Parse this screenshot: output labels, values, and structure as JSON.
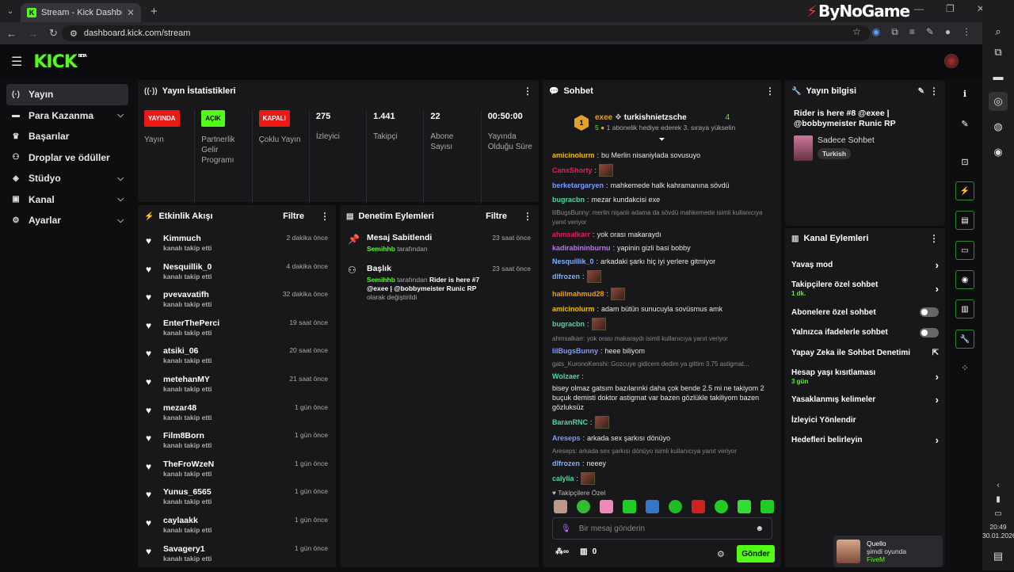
{
  "browser": {
    "tab_title": "Stream - Kick Dashboard",
    "url": "dashboard.kick.com/stream",
    "brand": "ByNoGame"
  },
  "kick": {
    "logo": "KICK",
    "beta": "BETA"
  },
  "sidebar": {
    "items": [
      {
        "label": "Yayın",
        "icon": "broadcast-icon",
        "active": true,
        "chev": false
      },
      {
        "label": "Para Kazanma",
        "icon": "money-icon",
        "active": false,
        "chev": true
      },
      {
        "label": "Başarılar",
        "icon": "trophy-icon",
        "active": false,
        "chev": false
      },
      {
        "label": "Droplar ve ödüller",
        "icon": "gift-icon",
        "active": false,
        "chev": false
      },
      {
        "label": "Stüdyo",
        "icon": "studio-icon",
        "active": false,
        "chev": true
      },
      {
        "label": "Kanal",
        "icon": "channel-icon",
        "active": false,
        "chev": true
      },
      {
        "label": "Ayarlar",
        "icon": "gear-icon",
        "active": false,
        "chev": true
      }
    ]
  },
  "stats": {
    "title": "Yayın İstatistikleri",
    "items": [
      {
        "badge": "YAYINDA",
        "badge_color": "#e91916",
        "label": "Yayın"
      },
      {
        "badge": "AÇIK",
        "badge_color": "#53fc18",
        "label": "Partnerlik Gelir Programı"
      },
      {
        "badge": "KAPALI",
        "badge_color": "#e91916",
        "label": "Çoklu Yayın"
      },
      {
        "num": "275",
        "label": "İzleyici"
      },
      {
        "num": "1.441",
        "label": "Takipçi"
      },
      {
        "num": "22",
        "label": "Abone Sayısı"
      },
      {
        "num": "00:50:00",
        "label": "Yayında Olduğu Süre"
      }
    ]
  },
  "activity": {
    "title": "Etkinlik Akışı",
    "filter": "Filtre",
    "items": [
      {
        "name": "Kimmuch",
        "action": "kanalı takip etti",
        "time": "2 dakika önce"
      },
      {
        "name": "Nesquillik_0",
        "action": "kanalı takip etti",
        "time": "4 dakika önce"
      },
      {
        "name": "pvevavatifh",
        "action": "kanalı takip etti",
        "time": "32 dakika önce"
      },
      {
        "name": "EnterThePerci",
        "action": "kanalı takip etti",
        "time": "19 saat önce"
      },
      {
        "name": "atsiki_06",
        "action": "kanalı takip etti",
        "time": "20 saat önce"
      },
      {
        "name": "metehanMY",
        "action": "kanalı takip etti",
        "time": "21 saat önce"
      },
      {
        "name": "mezar48",
        "action": "kanalı takip etti",
        "time": "1 gün önce"
      },
      {
        "name": "Film8Born",
        "action": "kanalı takip etti",
        "time": "1 gün önce"
      },
      {
        "name": "TheFroWzeN",
        "action": "kanalı takip etti",
        "time": "1 gün önce"
      },
      {
        "name": "Yunus_6565",
        "action": "kanalı takip etti",
        "time": "1 gün önce"
      },
      {
        "name": "caylaakk",
        "action": "kanalı takip etti",
        "time": "1 gün önce"
      },
      {
        "name": "Savagery1",
        "action": "kanalı takip etti",
        "time": "1 gün önce"
      }
    ]
  },
  "moderation": {
    "title": "Denetim Eylemleri",
    "filter": "Filtre",
    "items": [
      {
        "title": "Mesaj Sabitlendi",
        "user": "Semihhb",
        "by": "tarafından",
        "time": "23 saat önce",
        "icon": "pin-icon",
        "rest": ""
      },
      {
        "title": "Başlık",
        "user": "Semihhb",
        "by": "tarafından",
        "time": "23 saat önce",
        "icon": "title-icon",
        "rest": "Rider is here #7 @exee | @bobbymeister Runic RP",
        "suffix": "olarak değiştirildi"
      }
    ]
  },
  "chat": {
    "title": "Sohbet",
    "gifter": {
      "rank": "1",
      "name": "exee",
      "count": "5",
      "to": "turkishnietzsche",
      "gifts": "4",
      "note": "1 abonelik hediye ederek 3. sıraya yükselin"
    },
    "messages": [
      {
        "user": "amicinolurm",
        "color": "#f0c000",
        "text": "bu Merlin nisaniylada sovusuyo"
      },
      {
        "user": "CanxShorty",
        "color": "#e02060",
        "text": "",
        "emote": true
      },
      {
        "user": "berketargaryen",
        "color": "#7b9cff",
        "text": "mahkemede halk kahramanına sövdü"
      },
      {
        "user": "bugracbn",
        "color": "#53d6a0",
        "text": "mezar kundakcisi exe"
      },
      {
        "reply": "lilBugsBunny: merlin nişanlı adama da sövdü mahkemede isimli kullanıcıya yanıt veriyor",
        "user": "ahmsalkarr",
        "color": "#e02060",
        "text": "yok orası makaraydı"
      },
      {
        "user": "kadirabininburnu",
        "color": "#c070ff",
        "text": "yapinin gizli basi bobby"
      },
      {
        "user": "Nesquillik_0",
        "color": "#7bb0ff",
        "text": "arkadaki şarkı hiç iyi yerlere gitmiyor"
      },
      {
        "user": "dlfrozen",
        "color": "#7bb0ff",
        "text": "",
        "emote": true
      },
      {
        "user": "halilmahmud28",
        "color": "#f0a000",
        "text": "",
        "emote": true
      },
      {
        "user": "amicinolurm",
        "color": "#f0c000",
        "text": "adam bütün sunucuyla sovüsmus amk"
      },
      {
        "user": "bugracbn",
        "color": "#53d6a0",
        "text": "",
        "emote": true
      },
      {
        "reply": "ahmsalkarr: yok orası makaraydı isimli kullanıcıya yanıt veriyor",
        "user": "lilBugsBunny",
        "color": "#7b9cff",
        "text": "heee biliyom"
      },
      {
        "reply": "gats_KuronoKenshi: Gozcuye gidicem dedim ya gittim 3.75 astigmat...",
        "user": "Wolzaer",
        "color": "#53d6a0",
        "text": "bisey olmaz gatsım bazılarınki daha çok bende 2.5 mi ne takiyom 2 buçuk demisti doktor astigmat var bazen gözlükle takiliyom bazen gözluksüz"
      },
      {
        "user": "BaranRNC",
        "color": "#53d6a0",
        "text": "",
        "emote": true
      },
      {
        "user": "Areseps",
        "color": "#7b9cff",
        "text": "arkada sex şarkısı dönüyo"
      },
      {
        "reply": "Areseps: arkada sex şarkısı dönüyo isimli kullanıcıya yanıt veriyor",
        "user": "dlfrozen",
        "color": "#7bb0ff",
        "text": "neeey"
      },
      {
        "user": "calylia",
        "color": "#53d6a0",
        "text": "",
        "emote": true
      }
    ],
    "followers_only": "Takipçilere Özel",
    "placeholder": "Bir mesaj gönderin",
    "points": "0",
    "send": "Gönder"
  },
  "info": {
    "title": "Yayın bilgisi",
    "stream_title": "Rider is here #8 @exee | @bobbymeister Runic RP",
    "category": "Sadece Sohbet",
    "tag": "Turkish"
  },
  "channel_actions": {
    "title": "Kanal Eylemleri",
    "items": [
      {
        "label": "Yavaş mod",
        "type": "chev"
      },
      {
        "label": "Takipçilere özel sohbet",
        "sub": "1 dk.",
        "type": "chev"
      },
      {
        "label": "Abonelere özel sohbet",
        "type": "toggle"
      },
      {
        "label": "Yalnızca ifadelerle sohbet",
        "type": "toggle"
      },
      {
        "label": "Yapay Zeka ile Sohbet Denetimi",
        "type": "ext"
      },
      {
        "label": "Hesap yaşı kısıtlaması",
        "sub": "3 gün",
        "type": "chev"
      },
      {
        "label": "Yasaklanmış kelimeler",
        "type": "chev"
      },
      {
        "label": "İzleyici Yönlendir",
        "type": "none"
      },
      {
        "label": "Hedefleri belirleyin",
        "type": "chev"
      }
    ]
  },
  "taskbar": {
    "time": "20:49",
    "date": "30.01.2026"
  },
  "toast": {
    "name": "Quello",
    "status": "şimdi oyunda",
    "game": "FiveM"
  }
}
